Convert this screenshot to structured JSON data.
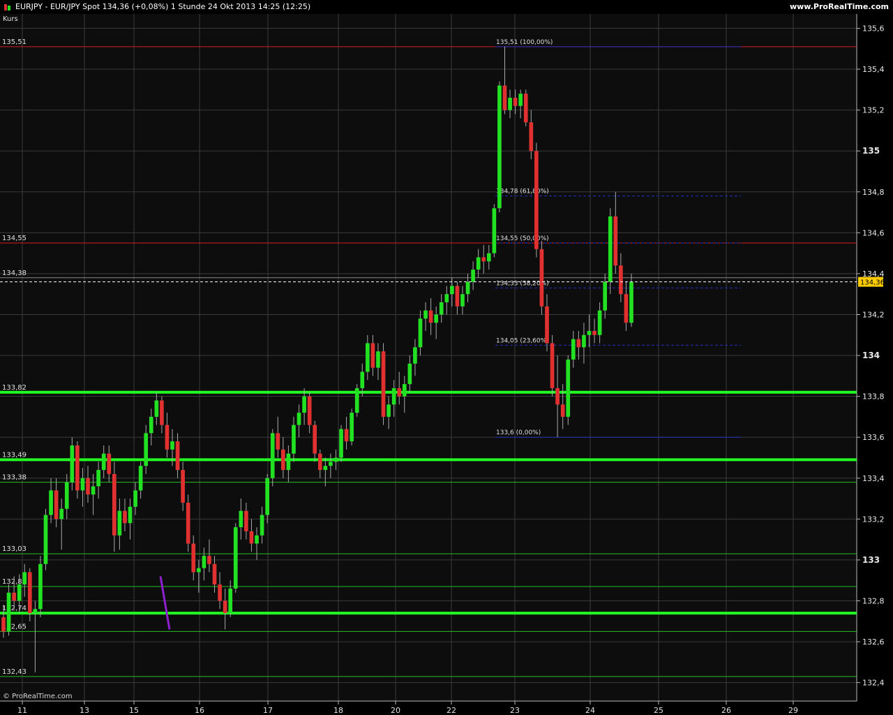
{
  "header": {
    "title": "EURJPY - EUR/JPY Spot    134,36 (+0,08%)    1 Stunde  24 Okt 2013 14:25 (12:25)",
    "site": "www.ProRealTime.com"
  },
  "pane_label": "Kurs",
  "credit": "© ProRealTime.com",
  "colors": {
    "bull": "#22e022",
    "bear": "#e03030",
    "bg": "#0d0d0d",
    "grid": "#3a3a3a",
    "support": "#22ff22",
    "resistance": "#d02020",
    "fib": "#2030c0",
    "last": "#ffcc00"
  },
  "chart_data": {
    "type": "candlestick",
    "title": "EURJPY - EUR/JPY Spot",
    "ylabel": "Kurs",
    "ylim": [
      132.31,
      135.67
    ],
    "y_ticks": [
      "132,4",
      "132,6",
      "132,8",
      "133",
      "133,2",
      "133,4",
      "133,6",
      "133,8",
      "134",
      "134,2",
      "134,4",
      "134,6",
      "134,8",
      "135",
      "135,2",
      "135,4",
      "135,6"
    ],
    "x_ticks": [
      "11",
      "13",
      "15",
      "16",
      "17",
      "18",
      "20",
      "22",
      "23",
      "24",
      "25",
      "26",
      "29"
    ],
    "last_price": "134,36",
    "last_price_value": 134.36,
    "horizontal_lines": [
      {
        "label": "135,51",
        "value": 135.51,
        "style": "resistance"
      },
      {
        "label": "134,55",
        "value": 134.55,
        "style": "resistance"
      },
      {
        "label": "134,38",
        "value": 134.38,
        "style": "thin"
      },
      {
        "label": "133,82",
        "value": 133.82,
        "style": "support-thick"
      },
      {
        "label": "133,49",
        "value": 133.49,
        "style": "support-thick"
      },
      {
        "label": "133,38",
        "value": 133.38,
        "style": "support-thin"
      },
      {
        "label": "133,03",
        "value": 133.03,
        "style": "support-thin"
      },
      {
        "label": "132,87",
        "value": 132.87,
        "style": "support-thin"
      },
      {
        "label": "132,74",
        "value": 132.74,
        "style": "support-thick"
      },
      {
        "label": "132,65",
        "value": 132.65,
        "style": "support-thin"
      },
      {
        "label": "132,43",
        "value": 132.43,
        "style": "support-thin"
      }
    ],
    "fibonacci": [
      {
        "label": "135,51 (100,00%)",
        "value": 135.51
      },
      {
        "label": "134,78 (61,80%)",
        "value": 134.78
      },
      {
        "label": "134,55 (50,00%)",
        "value": 134.55
      },
      {
        "label": "134,33 (38,20%)",
        "value": 134.33
      },
      {
        "label": "134,05 (23,60%)",
        "value": 134.05
      },
      {
        "label": "133,6 (0,00%)",
        "value": 133.6
      }
    ],
    "ohlc": [
      [
        132.72,
        132.78,
        132.62,
        132.65
      ],
      [
        132.65,
        132.88,
        132.63,
        132.84
      ],
      [
        132.84,
        132.92,
        132.76,
        132.8
      ],
      [
        132.8,
        132.93,
        132.74,
        132.88
      ],
      [
        132.88,
        132.98,
        132.82,
        132.94
      ],
      [
        132.94,
        132.96,
        132.7,
        132.74
      ],
      [
        132.74,
        132.8,
        132.45,
        132.76
      ],
      [
        132.76,
        133.02,
        132.72,
        132.98
      ],
      [
        132.98,
        133.25,
        132.95,
        133.22
      ],
      [
        133.22,
        133.4,
        133.18,
        133.34
      ],
      [
        133.34,
        133.4,
        133.16,
        133.2
      ],
      [
        133.2,
        133.3,
        133.05,
        133.25
      ],
      [
        133.25,
        133.42,
        133.2,
        133.38
      ],
      [
        133.38,
        133.6,
        133.34,
        133.56
      ],
      [
        133.56,
        133.58,
        133.3,
        133.34
      ],
      [
        133.34,
        133.45,
        133.26,
        133.4
      ],
      [
        133.4,
        133.46,
        133.28,
        133.32
      ],
      [
        133.32,
        133.42,
        133.22,
        133.36
      ],
      [
        133.36,
        133.48,
        133.3,
        133.44
      ],
      [
        133.44,
        133.56,
        133.4,
        133.52
      ],
      [
        133.52,
        133.56,
        133.38,
        133.42
      ],
      [
        133.42,
        133.48,
        133.04,
        133.12
      ],
      [
        133.12,
        133.3,
        133.05,
        133.24
      ],
      [
        133.24,
        133.3,
        133.14,
        133.18
      ],
      [
        133.18,
        133.3,
        133.1,
        133.26
      ],
      [
        133.26,
        133.38,
        133.22,
        133.34
      ],
      [
        133.34,
        133.48,
        133.3,
        133.46
      ],
      [
        133.46,
        133.66,
        133.42,
        133.62
      ],
      [
        133.62,
        133.74,
        133.56,
        133.7
      ],
      [
        133.7,
        133.82,
        133.66,
        133.78
      ],
      [
        133.78,
        133.8,
        133.62,
        133.66
      ],
      [
        133.66,
        133.72,
        133.5,
        133.54
      ],
      [
        133.54,
        133.64,
        133.46,
        133.58
      ],
      [
        133.58,
        133.62,
        133.4,
        133.44
      ],
      [
        133.44,
        133.48,
        133.24,
        133.28
      ],
      [
        133.28,
        133.32,
        133.04,
        133.08
      ],
      [
        133.08,
        133.12,
        132.9,
        132.94
      ],
      [
        132.94,
        133.0,
        132.84,
        132.96
      ],
      [
        132.96,
        133.06,
        132.9,
        133.02
      ],
      [
        133.02,
        133.1,
        132.94,
        132.98
      ],
      [
        132.98,
        133.02,
        132.84,
        132.88
      ],
      [
        132.88,
        132.94,
        132.76,
        132.8
      ],
      [
        132.8,
        132.86,
        132.66,
        132.74
      ],
      [
        132.74,
        132.9,
        132.72,
        132.86
      ],
      [
        132.86,
        133.18,
        132.84,
        133.16
      ],
      [
        133.16,
        133.3,
        133.1,
        133.24
      ],
      [
        133.24,
        133.28,
        133.1,
        133.14
      ],
      [
        133.14,
        133.2,
        133.04,
        133.08
      ],
      [
        133.08,
        133.16,
        133.0,
        133.12
      ],
      [
        133.12,
        133.26,
        133.08,
        133.22
      ],
      [
        133.22,
        133.42,
        133.18,
        133.4
      ],
      [
        133.4,
        133.64,
        133.36,
        133.62
      ],
      [
        133.62,
        133.7,
        133.5,
        133.54
      ],
      [
        133.54,
        133.6,
        133.4,
        133.44
      ],
      [
        133.44,
        133.56,
        133.38,
        133.52
      ],
      [
        133.52,
        133.7,
        133.48,
        133.66
      ],
      [
        133.66,
        133.76,
        133.6,
        133.72
      ],
      [
        133.72,
        133.84,
        133.66,
        133.8
      ],
      [
        133.8,
        133.82,
        133.62,
        133.66
      ],
      [
        133.66,
        133.68,
        133.48,
        133.52
      ],
      [
        133.52,
        133.54,
        133.4,
        133.44
      ],
      [
        133.44,
        133.5,
        133.36,
        133.46
      ],
      [
        133.46,
        133.52,
        133.4,
        133.48
      ],
      [
        133.48,
        133.54,
        133.44,
        133.5
      ],
      [
        133.5,
        133.66,
        133.48,
        133.64
      ],
      [
        133.64,
        133.7,
        133.54,
        133.58
      ],
      [
        133.58,
        133.74,
        133.56,
        133.72
      ],
      [
        133.72,
        133.86,
        133.7,
        133.84
      ],
      [
        133.84,
        133.96,
        133.8,
        133.92
      ],
      [
        133.92,
        134.1,
        133.88,
        134.06
      ],
      [
        134.06,
        134.1,
        133.9,
        133.94
      ],
      [
        133.94,
        134.06,
        133.88,
        134.02
      ],
      [
        134.02,
        134.06,
        133.66,
        133.7
      ],
      [
        133.7,
        133.8,
        133.64,
        133.76
      ],
      [
        133.76,
        133.88,
        133.7,
        133.84
      ],
      [
        133.84,
        133.92,
        133.76,
        133.8
      ],
      [
        133.8,
        133.9,
        133.72,
        133.86
      ],
      [
        133.86,
        134.0,
        133.82,
        133.96
      ],
      [
        133.96,
        134.08,
        133.9,
        134.04
      ],
      [
        134.04,
        134.22,
        134.0,
        134.18
      ],
      [
        134.18,
        134.26,
        134.12,
        134.22
      ],
      [
        134.22,
        134.28,
        134.1,
        134.16
      ],
      [
        134.16,
        134.24,
        134.08,
        134.2
      ],
      [
        134.2,
        134.3,
        134.16,
        134.26
      ],
      [
        134.26,
        134.34,
        134.2,
        134.3
      ],
      [
        134.3,
        134.38,
        134.24,
        134.34
      ],
      [
        134.34,
        134.36,
        134.2,
        134.24
      ],
      [
        134.24,
        134.34,
        134.2,
        134.3
      ],
      [
        134.3,
        134.4,
        134.26,
        134.36
      ],
      [
        134.36,
        134.46,
        134.32,
        134.42
      ],
      [
        134.42,
        134.52,
        134.38,
        134.48
      ],
      [
        134.48,
        134.54,
        134.4,
        134.46
      ],
      [
        134.46,
        134.54,
        134.42,
        134.5
      ],
      [
        134.5,
        134.74,
        134.48,
        134.72
      ],
      [
        134.72,
        135.34,
        134.7,
        135.32
      ],
      [
        135.32,
        135.51,
        135.18,
        135.2
      ],
      [
        135.2,
        135.3,
        135.16,
        135.26
      ],
      [
        135.26,
        135.3,
        135.18,
        135.22
      ],
      [
        135.22,
        135.3,
        135.16,
        135.28
      ],
      [
        135.28,
        135.3,
        135.12,
        135.14
      ],
      [
        135.14,
        135.2,
        134.96,
        135.0
      ],
      [
        135.0,
        135.04,
        134.48,
        134.52
      ],
      [
        134.52,
        134.56,
        134.2,
        134.24
      ],
      [
        134.24,
        134.3,
        134.02,
        134.06
      ],
      [
        134.06,
        134.1,
        133.8,
        133.84
      ],
      [
        133.84,
        134.0,
        133.6,
        133.76
      ],
      [
        133.76,
        133.86,
        133.64,
        133.7
      ],
      [
        133.7,
        134.0,
        133.66,
        133.98
      ],
      [
        133.98,
        134.12,
        133.94,
        134.08
      ],
      [
        134.08,
        134.12,
        133.98,
        134.04
      ],
      [
        134.04,
        134.16,
        133.96,
        134.1
      ],
      [
        134.1,
        134.2,
        134.04,
        134.12
      ],
      [
        134.12,
        134.18,
        134.06,
        134.1
      ],
      [
        134.1,
        134.26,
        134.06,
        134.22
      ],
      [
        134.22,
        134.4,
        134.18,
        134.36
      ],
      [
        134.36,
        134.72,
        134.3,
        134.68
      ],
      [
        134.68,
        134.8,
        134.4,
        134.44
      ],
      [
        134.44,
        134.5,
        134.26,
        134.3
      ],
      [
        134.3,
        134.36,
        134.12,
        134.16
      ],
      [
        134.16,
        134.4,
        134.14,
        134.36
      ]
    ]
  }
}
